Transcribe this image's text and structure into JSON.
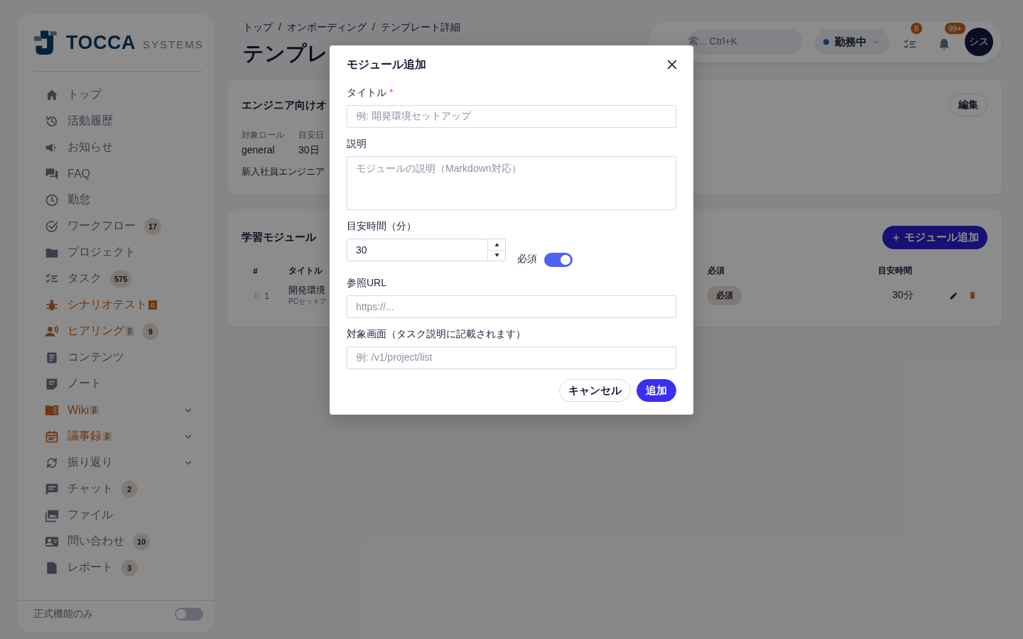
{
  "sidebar": {
    "logo": {
      "brand": "TOCCA",
      "suffix": "SYSTEMS"
    },
    "items": [
      {
        "label": "トップ",
        "preview": false
      },
      {
        "label": "活動履歴",
        "preview": false
      },
      {
        "label": "お知らせ",
        "preview": false
      },
      {
        "label": "FAQ",
        "preview": false
      },
      {
        "label": "勤怠",
        "preview": false
      },
      {
        "label": "ワークフロー",
        "preview": false,
        "badge": "17"
      },
      {
        "label": "プロジェクト",
        "preview": false
      },
      {
        "label": "タスク",
        "preview": false,
        "badge": "575"
      },
      {
        "label": "シナリオテスト",
        "preview": true,
        "tag": "α"
      },
      {
        "label": "ヒアリング",
        "preview": true,
        "tag": "β",
        "badge": "9"
      },
      {
        "label": "コンテンツ",
        "preview": false
      },
      {
        "label": "ノート",
        "preview": false
      },
      {
        "label": "Wiki",
        "preview": true,
        "tag": "β",
        "expanded": false
      },
      {
        "label": "議事録",
        "preview": true,
        "tag": "β",
        "expanded": false
      },
      {
        "label": "振り返り",
        "preview": false,
        "expanded": false
      },
      {
        "label": "チャット",
        "preview": false,
        "badge": "2"
      },
      {
        "label": "ファイル",
        "preview": false
      },
      {
        "label": "問い合わせ",
        "preview": false,
        "badge": "10"
      },
      {
        "label": "レポート",
        "preview": false,
        "badge": "3"
      }
    ],
    "footer_toggle": {
      "label": "正式機能のみ",
      "on": false
    }
  },
  "header": {
    "breadcrumb": [
      "トップ",
      "オンボーディング",
      "テンプレート詳細"
    ],
    "separator": "/",
    "title": "テンプレ",
    "search": {
      "placeholder": "索... Ctrl+K"
    },
    "status": {
      "label": "勤務中"
    },
    "task_badge": "8",
    "notification_badge": "99+",
    "avatar": "シス"
  },
  "template_card": {
    "title": "エンジニア向けオ",
    "edit_button": "編集",
    "meta": [
      {
        "label": "対象ロール",
        "value": "general"
      },
      {
        "label": "目安日",
        "value": "30日"
      }
    ],
    "description": "新入社員エンジニア"
  },
  "modules_card": {
    "title": "学習モジュール",
    "add_button": "＋ モジュール追加",
    "columns": [
      "#",
      "タイトル",
      "必須",
      "目安時間"
    ],
    "rows": [
      {
        "number": "1",
        "title": "開発環境",
        "subtitle": "PCセットア",
        "required": "必須",
        "duration": "30分"
      }
    ]
  },
  "modal": {
    "title": "モジュール追加",
    "fields": [
      {
        "kind": "text",
        "label": "タイトル",
        "required_mark": "*",
        "placeholder": "例: 開発環境セットアップ"
      },
      {
        "kind": "textarea",
        "label": "説明",
        "placeholder": "モジュールの説明（Markdown対応）"
      },
      {
        "kind": "number",
        "label": "目安時間（分）",
        "value": "30",
        "toggle": {
          "label": "必須",
          "on": true
        }
      },
      {
        "kind": "text",
        "label": "参照URL",
        "placeholder": "https://..."
      },
      {
        "kind": "text",
        "label": "対象画面（タスク説明に記載されます）",
        "placeholder": "例: /v1/project/list"
      }
    ],
    "buttons": [
      {
        "label": "キャンセル",
        "primary": false
      },
      {
        "label": "追加",
        "primary": true
      }
    ]
  }
}
